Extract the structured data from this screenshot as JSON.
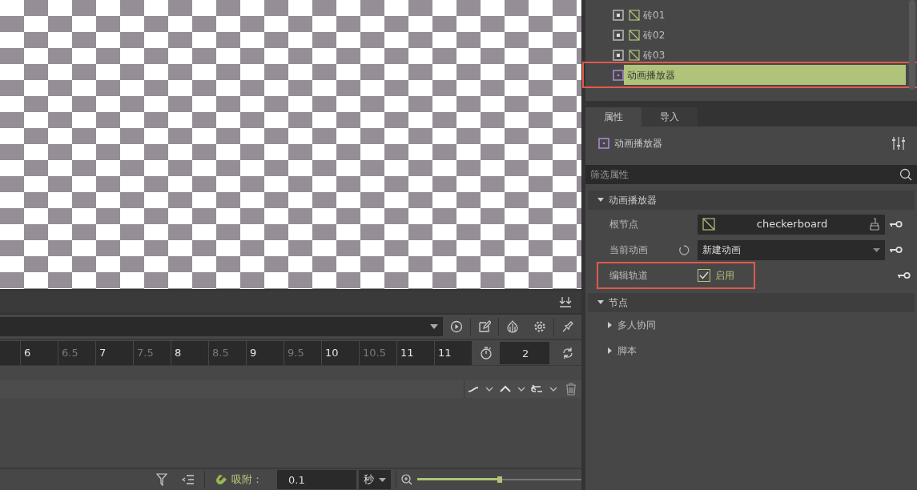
{
  "viewport": {
    "kind": "render"
  },
  "animation_panel": {
    "ruler": [
      {
        "label": "6",
        "major": true
      },
      {
        "label": "6.5",
        "major": false
      },
      {
        "label": "7",
        "major": true
      },
      {
        "label": "7.5",
        "major": false
      },
      {
        "label": "8",
        "major": true
      },
      {
        "label": "8.5",
        "major": false
      },
      {
        "label": "9",
        "major": true
      },
      {
        "label": "9.5",
        "major": false
      },
      {
        "label": "10",
        "major": true
      },
      {
        "label": "10.5",
        "major": false
      },
      {
        "label": "11",
        "major": true
      },
      {
        "label": "11",
        "major": true
      }
    ],
    "length": "2",
    "snap": {
      "label": "吸附：",
      "value": "0.1",
      "unit": "秒"
    },
    "zoom": {
      "level": 0.5
    }
  },
  "scene_tree": {
    "items": [
      {
        "label": "砖01",
        "kind": "mesh",
        "selected": false,
        "highlighted": false
      },
      {
        "label": "砖02",
        "kind": "mesh",
        "selected": false,
        "highlighted": false
      },
      {
        "label": "砖03",
        "kind": "mesh",
        "selected": false,
        "highlighted": false
      },
      {
        "label": "动画播放器",
        "kind": "player",
        "selected": true,
        "highlighted": true
      }
    ]
  },
  "inspector": {
    "tabs": [
      {
        "label": "属性",
        "selected": true
      },
      {
        "label": "导入",
        "selected": false
      }
    ],
    "object_name": "动画播放器",
    "filter": {
      "placeholder": "筛选属性"
    },
    "sections": [
      {
        "label": "动画播放器",
        "expanded": true,
        "properties": [
          {
            "label": "根节点",
            "kind": "node",
            "value": "checkerboard",
            "highlighted": false
          },
          {
            "label": "当前动画",
            "kind": "dropdown",
            "value": "新建动画",
            "highlighted": false
          },
          {
            "label": "编辑轨道",
            "kind": "checkbox",
            "checked": true,
            "value": "启用",
            "highlighted": true
          }
        ]
      },
      {
        "label": "节点",
        "expanded": true,
        "subsections": [
          {
            "label": "多人协同",
            "expanded": false
          },
          {
            "label": "脚本",
            "expanded": false
          }
        ]
      }
    ]
  }
}
